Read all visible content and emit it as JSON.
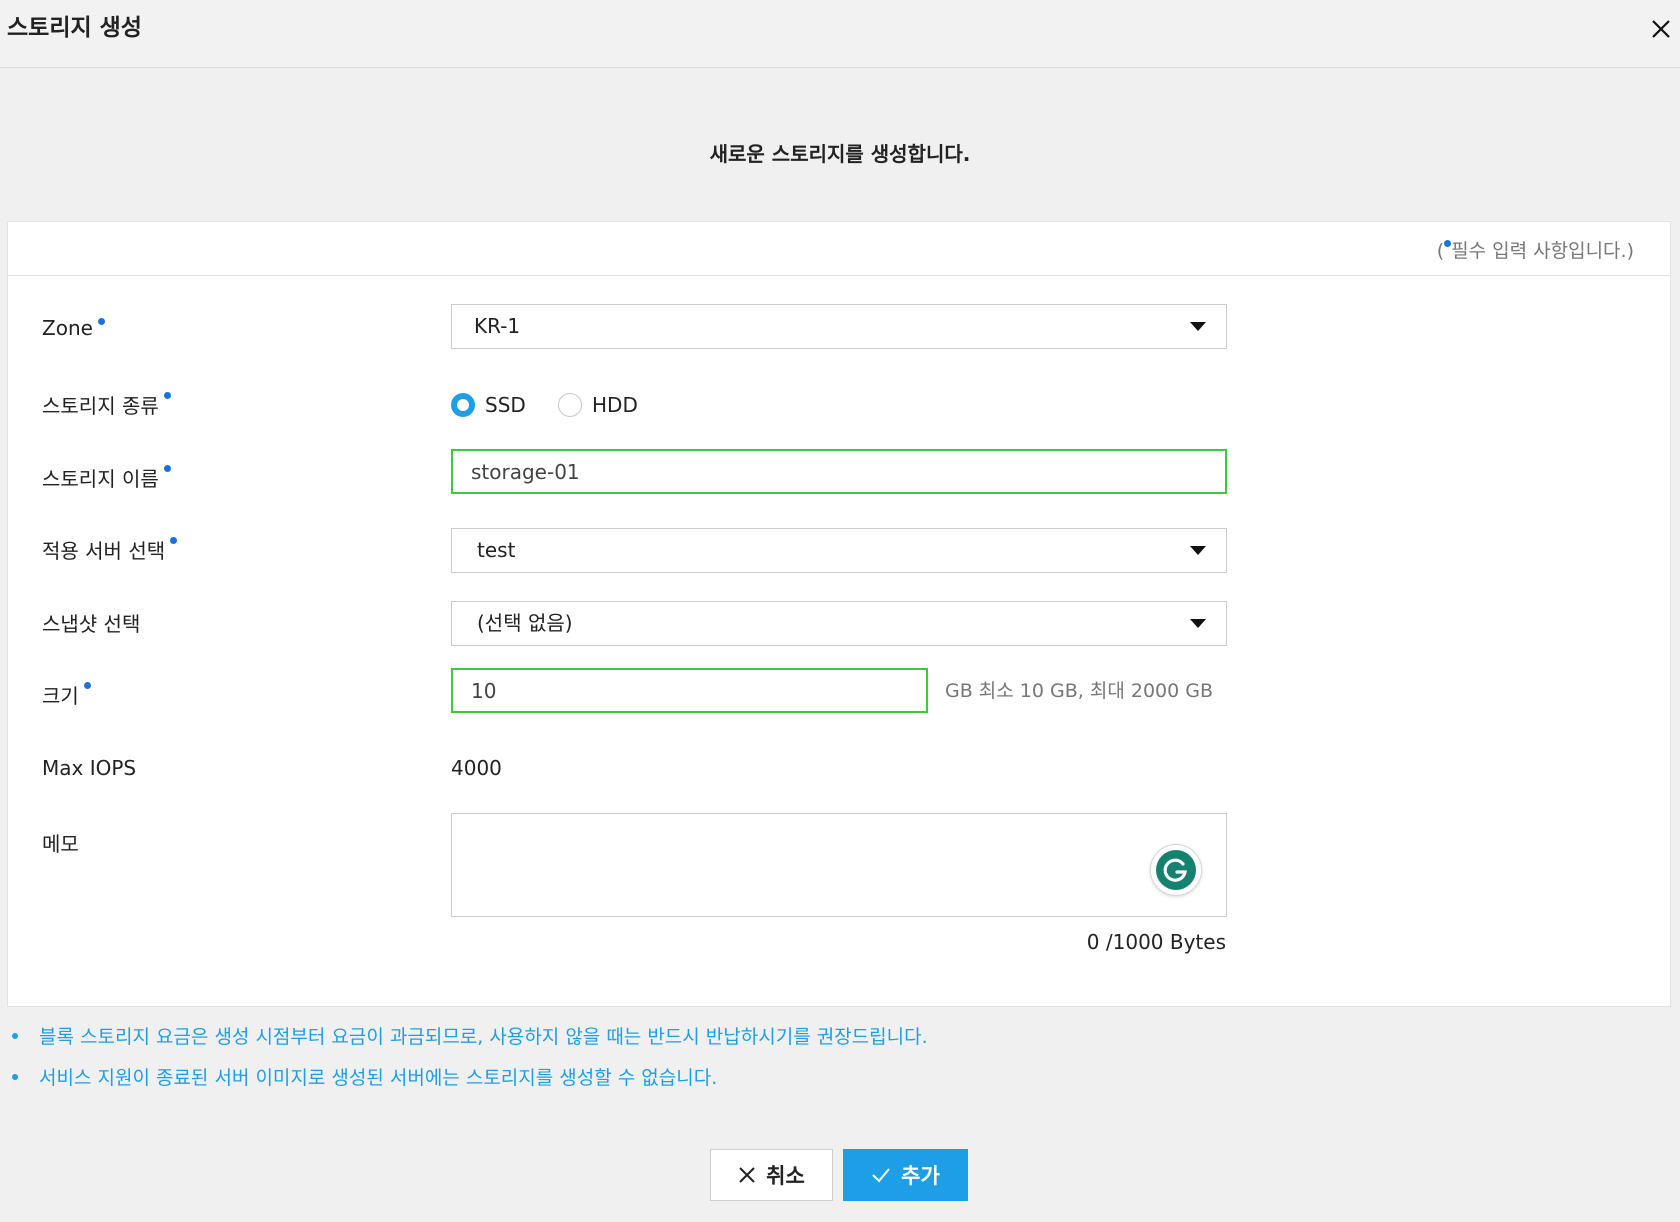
{
  "dialog": {
    "title": "스토리지 생성",
    "subtitle": "새로운 스토리지를 생성합니다.",
    "close_icon": "close-icon"
  },
  "form": {
    "required_note_prefix": "(",
    "required_note_text": "필수 입력 사항입니다.)",
    "zone": {
      "label": "Zone",
      "value": "KR-1"
    },
    "storage_type": {
      "label": "스토리지 종류",
      "options": [
        {
          "label": "SSD",
          "checked": true
        },
        {
          "label": "HDD",
          "checked": false
        }
      ]
    },
    "storage_name": {
      "label": "스토리지 이름",
      "value": "storage-01"
    },
    "server": {
      "label": "적용 서버 선택",
      "value": "test"
    },
    "snapshot": {
      "label": "스냅샷 선택",
      "value": "(선택 없음)"
    },
    "size": {
      "label": "크기",
      "value": "10",
      "hint": "GB  최소 10 GB, 최대 2000 GB"
    },
    "max_iops": {
      "label": "Max IOPS",
      "value": "4000"
    },
    "memo": {
      "label": "메모",
      "value": "",
      "byte_count": "0 /1000 Bytes"
    }
  },
  "notes": [
    "블록 스토리지 요금은 생성 시점부터 요금이 과금되므로, 사용하지 않을 때는 반드시 반납하시기를 권장드립니다.",
    "서비스 지원이 종료된 서버 이미지로 생성된 서버에는 스토리지를 생성할 수 없습니다."
  ],
  "buttons": {
    "cancel": "취소",
    "add": "추가"
  },
  "colors": {
    "accent": "#1e9ee6",
    "required_dot": "#1a73d9",
    "valid_border": "#3ccb3c"
  }
}
